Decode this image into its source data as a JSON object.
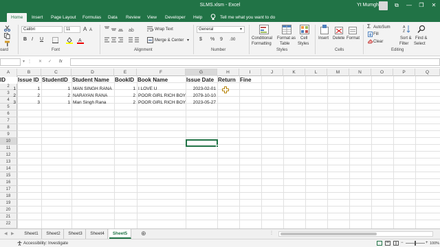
{
  "title": "SLMS.xlsm  -  Excel",
  "user": "Yt Mumgh",
  "window_controls": {
    "ribbon_display": "⧉",
    "minimize": "—",
    "restore": "❐",
    "close": "✕"
  },
  "ribbon_tabs": [
    "Home",
    "Insert",
    "Page Layout",
    "Formulas",
    "Data",
    "Review",
    "View",
    "Developer",
    "Help"
  ],
  "tell_me": "Tell me what you want to do",
  "font": {
    "name": "Calibri",
    "size": "11",
    "bold": "B",
    "italic": "I",
    "underline": "U",
    "grow": "A",
    "shrink": "A"
  },
  "alignment": {
    "wrap": "Wrap Text",
    "merge": "Merge & Center"
  },
  "number": {
    "format": "General",
    "currency": "$",
    "percent": "%",
    "comma": "9",
    "inc_dec": ".00"
  },
  "styles": {
    "conditional": "Conditional",
    "formatting": "Formatting",
    "format_as": "Format as",
    "table": "Table",
    "cell": "Cell",
    "cell_styles": "Styles"
  },
  "cells": {
    "insert": "Insert",
    "delete": "Delete",
    "format": "Format"
  },
  "editing": {
    "autosum": "AutoSum",
    "fill": "Fill",
    "clear": "Clear",
    "sort": "Sort &",
    "filter": "Filter",
    "find": "Find &",
    "select": "Select"
  },
  "groups": {
    "clipboard": "oard",
    "font": "Font",
    "alignment": "Alignment",
    "number": "Number",
    "styles": "Styles",
    "cells": "Cells",
    "editing": "Editing"
  },
  "formula_bar": {
    "name_box": "",
    "cancel": "✕",
    "enter": "✓",
    "fx": "fx",
    "value": ""
  },
  "columns": [
    "A",
    "B",
    "C",
    "D",
    "E",
    "F",
    "G",
    "H",
    "I",
    "J",
    "K",
    "L",
    "M",
    "N",
    "O",
    "P",
    "Q"
  ],
  "rows": [
    "1",
    "2",
    "3",
    "4",
    "5",
    "6",
    "7",
    "8",
    "9",
    "10",
    "11",
    "12",
    "13",
    "14",
    "15",
    "16",
    "17",
    "18",
    "19",
    "20",
    "21",
    "22"
  ],
  "headers": {
    "a": "ID",
    "b": "Issue ID",
    "c": "StudentID",
    "d": "Student Name",
    "e": "BookID",
    "f": "Book Name",
    "g": "Issue Date",
    "h": "Return",
    "i": "Fine"
  },
  "data": [
    {
      "a": "1",
      "b": "1",
      "c": "1",
      "d": "MAN SINGH RANA",
      "e": "1",
      "f": "I LOVE U",
      "g": "2023-02-01"
    },
    {
      "a": "2",
      "b": "2",
      "c": "2",
      "d": "NARAYAN RANA",
      "e": "2",
      "f": "POOR GIRL RICH BOYS",
      "g": "2079-10-10"
    },
    {
      "a": "3",
      "b": "3",
      "c": "1",
      "d": "Man Singh Rana",
      "e": "2",
      "f": "POOR GIRL RICH BOYS",
      "g": "2023-05-27"
    }
  ],
  "sheets": [
    "Sheet1",
    "Sheet2",
    "Sheet3",
    "Sheet4",
    "Sheet5"
  ],
  "active_sheet": "Sheet5",
  "status": {
    "accessibility": "Accessibility: Investigate",
    "zoom": "100%"
  },
  "colors": {
    "excel_green": "#217346"
  }
}
